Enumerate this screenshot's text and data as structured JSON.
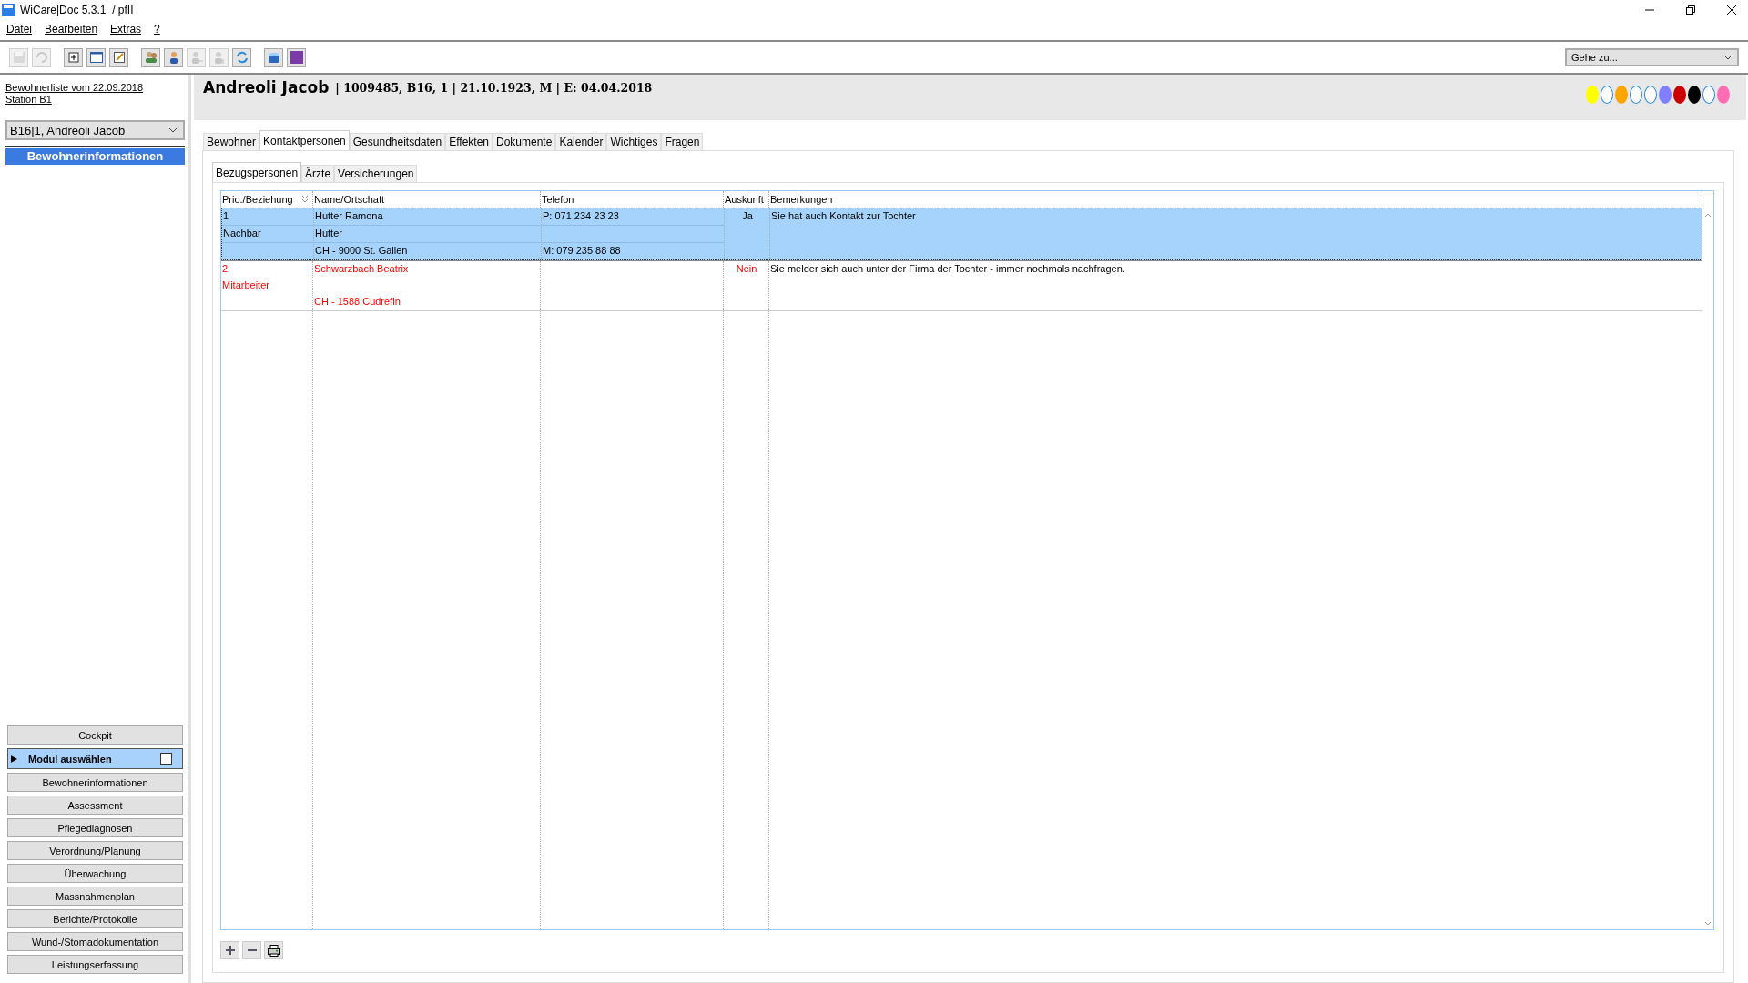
{
  "window": {
    "title": "WiCare|Doc 5.3.1  / pfII"
  },
  "menu": [
    {
      "label": "Datei"
    },
    {
      "label": "Bearbeiten"
    },
    {
      "label": "Extras"
    },
    {
      "label": "?"
    }
  ],
  "toolbar": [
    {
      "kind": "save",
      "disabled": true
    },
    {
      "kind": "undo",
      "disabled": true
    },
    {
      "kind": "add",
      "disabled": false
    },
    {
      "kind": "window",
      "disabled": false
    },
    {
      "kind": "edit",
      "disabled": false
    },
    {
      "kind": "people",
      "disabled": false
    },
    {
      "kind": "person",
      "disabled": false
    },
    {
      "kind": "person-out",
      "disabled": true
    },
    {
      "kind": "person-in",
      "disabled": true
    },
    {
      "kind": "refresh",
      "disabled": false
    },
    {
      "kind": "box",
      "disabled": false
    },
    {
      "kind": "square",
      "disabled": false
    }
  ],
  "goto": {
    "value": "Gehe zu..."
  },
  "sidebar": {
    "list_link": "Bewohnerliste vom 22.09.2018",
    "station_link": "Station B1",
    "resident": "B16|1, Andreoli Jacob",
    "section_title": "Bewohnerinformationen",
    "modules": [
      {
        "label": "Cockpit",
        "kind": "button",
        "selected": false
      },
      {
        "label": "Modul auswählen",
        "kind": "picker",
        "selected": true,
        "checked": false
      },
      {
        "label": "Bewohnerinformationen",
        "kind": "button",
        "selected": false
      },
      {
        "label": "Assessment",
        "kind": "button",
        "selected": false
      },
      {
        "label": "Pflegediagnosen",
        "kind": "button",
        "selected": false
      },
      {
        "label": "Verordnung/Planung",
        "kind": "button",
        "selected": false
      },
      {
        "label": "Überwachung",
        "kind": "button",
        "selected": false
      },
      {
        "label": "Massnahmenplan",
        "kind": "button",
        "selected": false
      },
      {
        "label": "Berichte/Protokolle",
        "kind": "button",
        "selected": false
      },
      {
        "label": "Wund-/Stomadokumentation",
        "kind": "button",
        "selected": false
      },
      {
        "label": "Leistungserfassung",
        "kind": "button",
        "selected": false
      }
    ]
  },
  "header": {
    "name": "Andreoli Jacob",
    "details": "| 1009485, B16, 1 | 21.10.1923, M | E: 04.04.2018",
    "dots": [
      {
        "color": "#ffff00",
        "kind": "filled"
      },
      {
        "color": "#ffffff",
        "kind": "outline"
      },
      {
        "color": "#ffa500",
        "kind": "filled"
      },
      {
        "color": "#ffffff",
        "kind": "outline"
      },
      {
        "color": "#ffffff",
        "kind": "outline"
      },
      {
        "color": "#8080ff",
        "kind": "filled"
      },
      {
        "color": "#cc0000",
        "kind": "filled"
      },
      {
        "color": "#000000",
        "kind": "filled"
      },
      {
        "color": "#ffffff",
        "kind": "outline"
      },
      {
        "color": "#ff6eb4",
        "kind": "filled"
      }
    ]
  },
  "tabs": [
    {
      "label": "Bewohner",
      "selected": false
    },
    {
      "label": "Kontaktpersonen",
      "selected": true
    },
    {
      "label": "Gesundheitsdaten",
      "selected": false
    },
    {
      "label": "Effekten",
      "selected": false
    },
    {
      "label": "Dokumente",
      "selected": false
    },
    {
      "label": "Kalender",
      "selected": false
    },
    {
      "label": "Wichtiges",
      "selected": false
    },
    {
      "label": "Fragen",
      "selected": false
    }
  ],
  "subtabs": [
    {
      "label": "Bezugspersonen",
      "selected": true
    },
    {
      "label": "Ärzte",
      "selected": false
    },
    {
      "label": "Versicherungen",
      "selected": false
    }
  ],
  "table": {
    "columns": [
      "Prio./Beziehung",
      "Name/Ortschaft",
      "Telefon",
      "Auskunft",
      "Bemerkungen"
    ],
    "rows": [
      {
        "selected": true,
        "alert": false,
        "prio": "1",
        "relation": "Nachbar",
        "name": "Hutter Ramona",
        "name2": "Hutter",
        "place": "CH - 9000 St. Gallen",
        "phone1": "P: 071 234 23 23",
        "phone2": "M: 079 235 88 88",
        "info": "Ja",
        "remarks": "Sie hat auch Kontakt zur Tochter"
      },
      {
        "selected": false,
        "alert": true,
        "prio": "2",
        "relation": "Mitarbeiter",
        "name": "Schwarzbach Beatrix",
        "place": "CH - 1588 Cudrefin",
        "info": "Nein",
        "remarks": "Sie melder sich auch unter der Firma der Tochter - immer nochmals nachfragen."
      }
    ]
  }
}
